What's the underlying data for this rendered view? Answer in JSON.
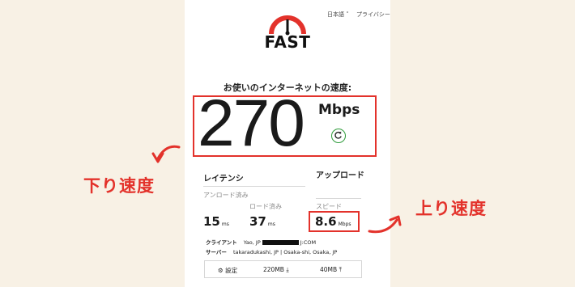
{
  "nav": {
    "language": "日本語",
    "privacy": "プライバシー"
  },
  "brand": {
    "logo_text": "FAST",
    "accent_color": "#e3322b"
  },
  "main": {
    "heading": "お使いのインターネットの速度:",
    "speed_value": "270",
    "speed_unit": "Mbps"
  },
  "latency": {
    "title": "レイテンシ",
    "unloaded_label": "アンロード済み",
    "unloaded_value": "15",
    "unloaded_unit": "ms",
    "loaded_label": "ロード済み",
    "loaded_value": "37",
    "loaded_unit": "ms"
  },
  "upload": {
    "title": "アップロード",
    "label": "スピード",
    "value": "8.6",
    "unit": "Mbps"
  },
  "info": {
    "client_label": "クライアント",
    "client_location": "Yao, JP",
    "client_isp_suffix": "J:COM",
    "server_label": "サーバー",
    "servers": "takaradukashi, JP | Osaka-shi, Osaka, JP"
  },
  "bottom": {
    "settings_label": "設定",
    "download_size": "220MB",
    "upload_size": "40MB"
  },
  "annotations": {
    "download_label": "下り速度",
    "upload_label": "上り速度",
    "color": "#e3322b"
  }
}
